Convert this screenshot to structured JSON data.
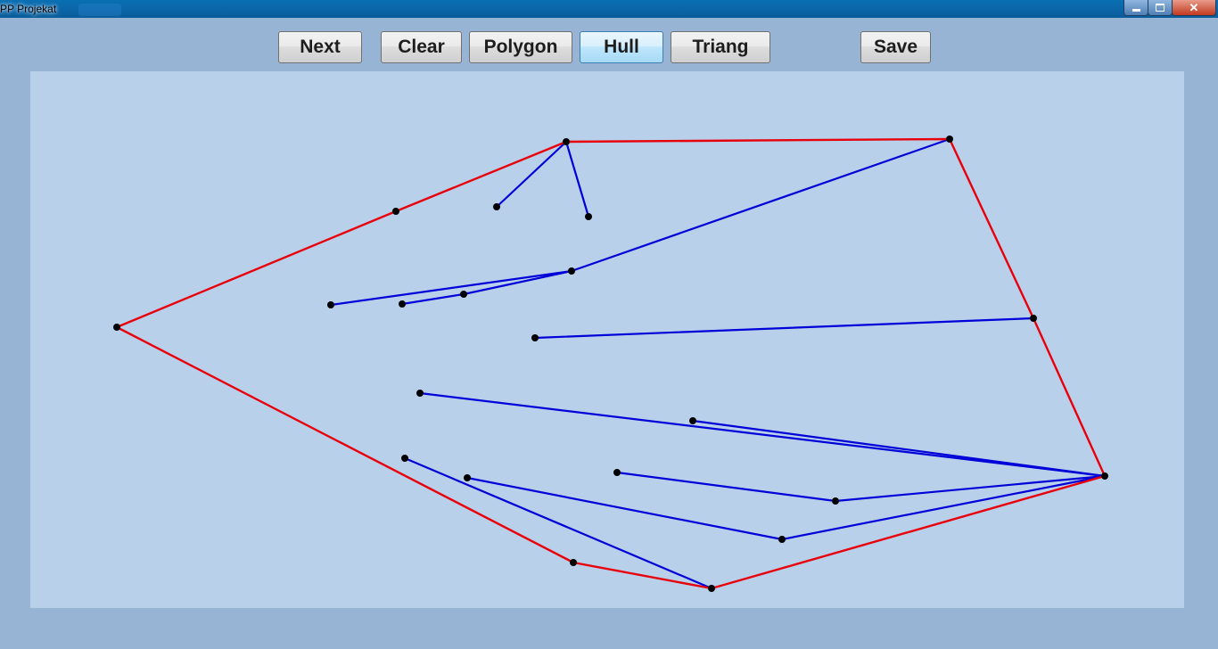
{
  "window": {
    "title": "PP Projekat"
  },
  "toolbar": {
    "next_label": "Next",
    "clear_label": "Clear",
    "polygon_label": "Polygon",
    "hull_label": "Hull",
    "triang_label": "Triang",
    "save_label": "Save"
  },
  "colors": {
    "hull": "#e8000b",
    "tree": "#0000d8",
    "point": "#000000",
    "canvas": "#b8d0ea"
  },
  "icons": {
    "minimize": "minimize-icon",
    "maximize": "maximize-icon",
    "close": "close-icon"
  }
}
